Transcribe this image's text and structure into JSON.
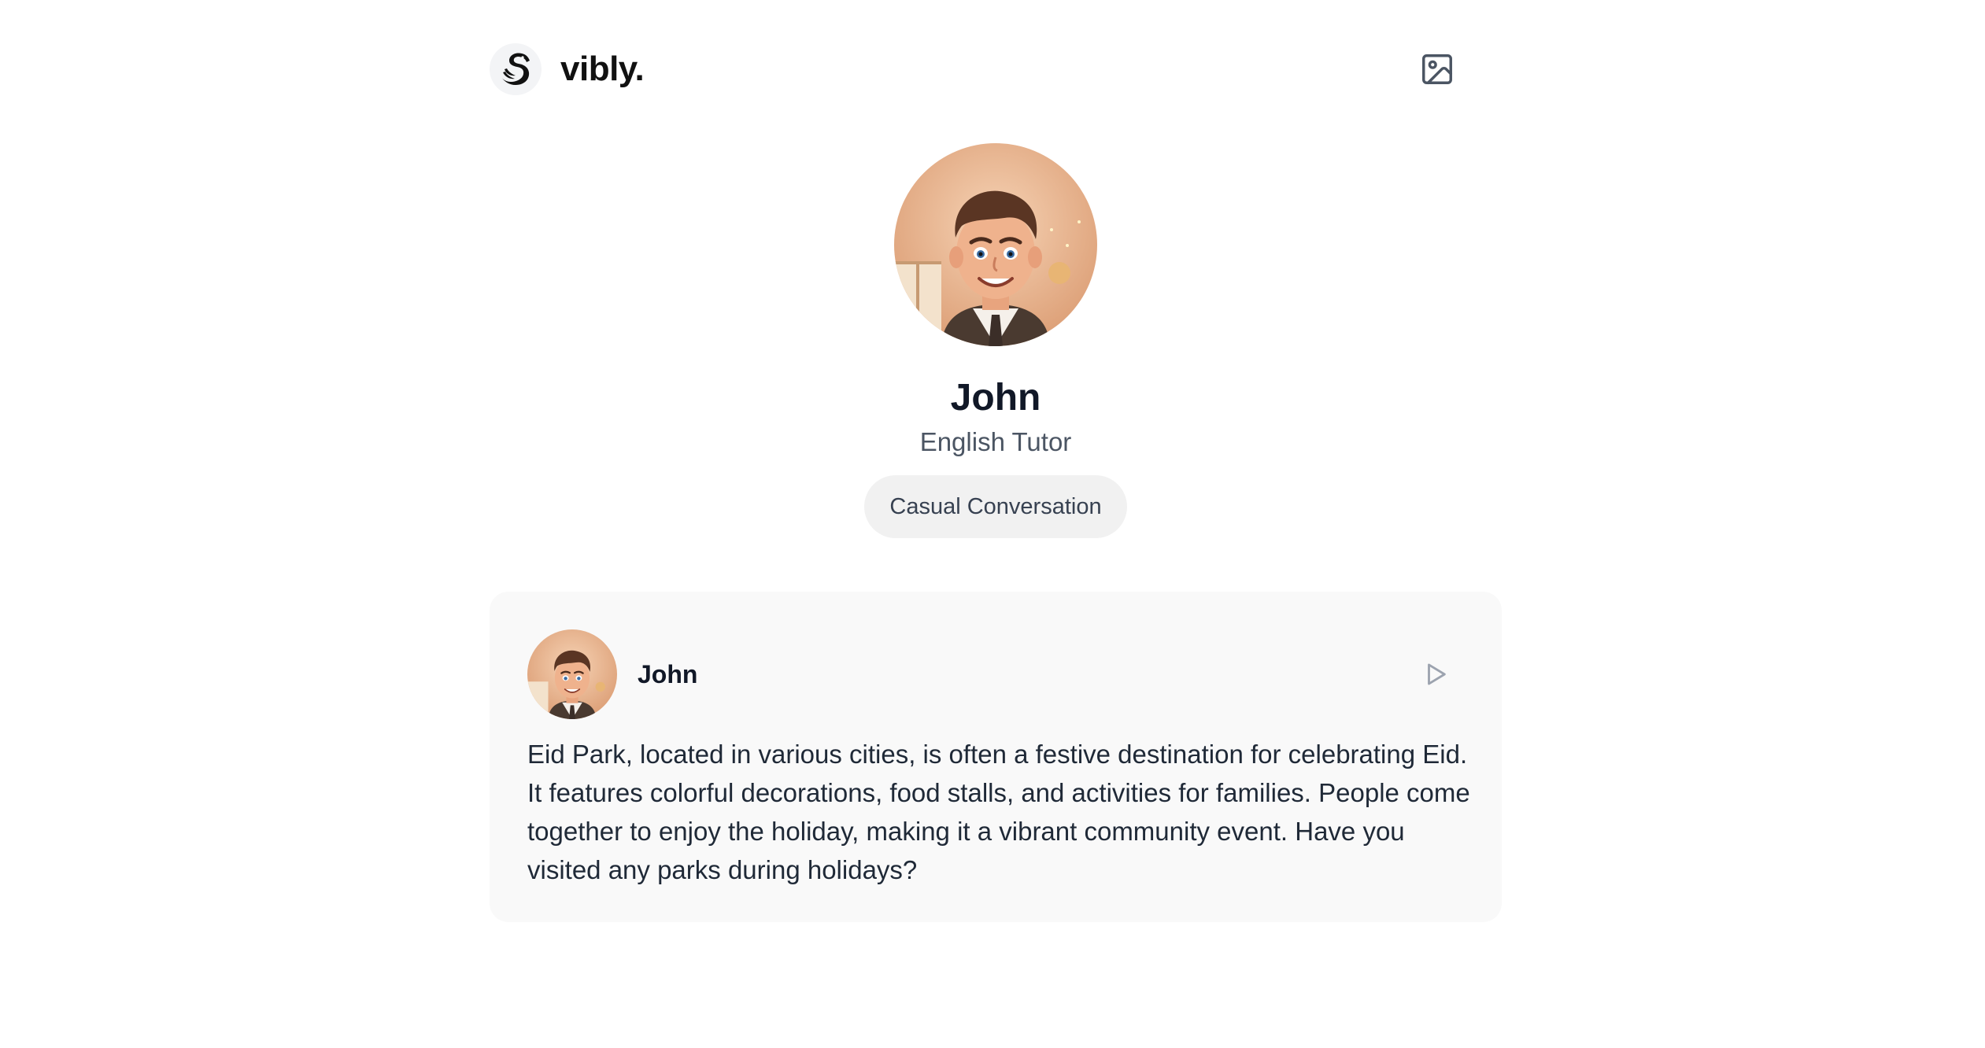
{
  "app": {
    "brand": "vibly.",
    "logo_icon": "swan-icon",
    "image_icon": "image-icon"
  },
  "profile": {
    "name": "John",
    "role": "English Tutor",
    "mode": "Casual Conversation"
  },
  "message": {
    "author": "John",
    "play_icon": "play-icon",
    "text": "Eid Park, located in various cities, is often a festive destination for celebrating Eid. It features colorful decorations, food stalls, and activities for families. People come together to enjoy the holiday, making it a vibrant community event. Have you visited any parks during holidays?"
  },
  "colors": {
    "pill_bg": "#f1f1f1",
    "card_bg": "#f9f9f9",
    "text_primary": "#111827",
    "text_secondary": "#4b5563"
  }
}
